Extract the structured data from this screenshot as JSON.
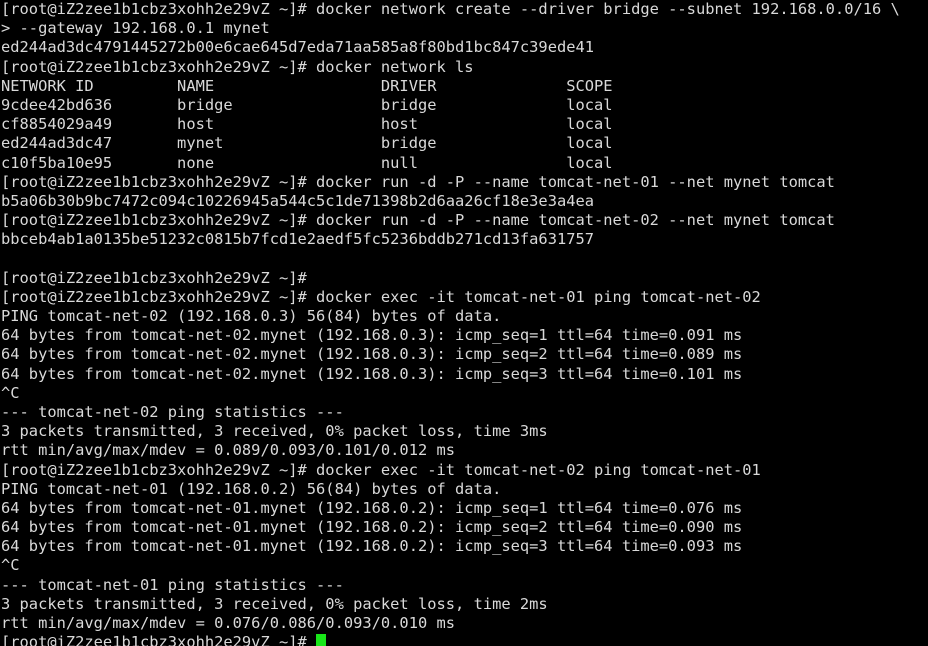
{
  "terminal": {
    "title": "root@iZ2zee1b1cbz3xohh2e29vZ",
    "prompt": "[root@iZ2zee1b1cbz3xohh2e29vZ ~]#",
    "continuation_prompt": ">",
    "foreground_color": "#d9d9d9",
    "background_color": "#000000",
    "cursor_color": "#19e619",
    "columns": 96,
    "rows": 34
  },
  "lines": [
    "[root@iZ2zee1b1cbz3xohh2e29vZ ~]# docker network create --driver bridge --subnet 192.168.0.0/16 \\",
    "> --gateway 192.168.0.1 mynet",
    "ed244ad3dc4791445272b00e6cae645d7eda71aa585a8f80bd1bc847c39ede41",
    "[root@iZ2zee1b1cbz3xohh2e29vZ ~]# docker network ls",
    "NETWORK ID         NAME                  DRIVER              SCOPE",
    "9cdee42bd636       bridge                bridge              local",
    "cf8854029a49       host                  host                local",
    "ed244ad3dc47       mynet                 bridge              local",
    "c10f5ba10e95       none                  null                local",
    "[root@iZ2zee1b1cbz3xohh2e29vZ ~]# docker run -d -P --name tomcat-net-01 --net mynet tomcat",
    "b5a06b30b9bc7472c094c10226945a544c5c1de71398b2d6aa26cf18e3e3a4ea",
    "[root@iZ2zee1b1cbz3xohh2e29vZ ~]# docker run -d -P --name tomcat-net-02 --net mynet tomcat",
    "bbceb4ab1a0135be51232c0815b7fcd1e2aedf5fc5236bddb271cd13fa631757",
    "",
    "[root@iZ2zee1b1cbz3xohh2e29vZ ~]#",
    "[root@iZ2zee1b1cbz3xohh2e29vZ ~]# docker exec -it tomcat-net-01 ping tomcat-net-02",
    "PING tomcat-net-02 (192.168.0.3) 56(84) bytes of data.",
    "64 bytes from tomcat-net-02.mynet (192.168.0.3): icmp_seq=1 ttl=64 time=0.091 ms",
    "64 bytes from tomcat-net-02.mynet (192.168.0.3): icmp_seq=2 ttl=64 time=0.089 ms",
    "64 bytes from tomcat-net-02.mynet (192.168.0.3): icmp_seq=3 ttl=64 time=0.101 ms",
    "^C",
    "--- tomcat-net-02 ping statistics ---",
    "3 packets transmitted, 3 received, 0% packet loss, time 3ms",
    "rtt min/avg/max/mdev = 0.089/0.093/0.101/0.012 ms",
    "[root@iZ2zee1b1cbz3xohh2e29vZ ~]# docker exec -it tomcat-net-02 ping tomcat-net-01",
    "PING tomcat-net-01 (192.168.0.2) 56(84) bytes of data.",
    "64 bytes from tomcat-net-01.mynet (192.168.0.2): icmp_seq=1 ttl=64 time=0.076 ms",
    "64 bytes from tomcat-net-01.mynet (192.168.0.2): icmp_seq=2 ttl=64 time=0.090 ms",
    "64 bytes from tomcat-net-01.mynet (192.168.0.2): icmp_seq=3 ttl=64 time=0.093 ms",
    "^C",
    "--- tomcat-net-01 ping statistics ---",
    "3 packets transmitted, 3 received, 0% packet loss, time 2ms",
    "rtt min/avg/max/mdev = 0.076/0.086/0.093/0.010 ms"
  ],
  "prompt_line": {
    "text": "[root@iZ2zee1b1cbz3xohh2e29vZ ~]# ",
    "cursor": "block"
  },
  "network_table": {
    "headers": [
      "NETWORK ID",
      "NAME",
      "DRIVER",
      "SCOPE"
    ],
    "rows": [
      [
        "9cdee42bd636",
        "bridge",
        "bridge",
        "local"
      ],
      [
        "cf8854029a49",
        "host",
        "host",
        "local"
      ],
      [
        "ed244ad3dc47",
        "mynet",
        "bridge",
        "local"
      ],
      [
        "c10f5ba10e95",
        "none",
        "null",
        "local"
      ]
    ]
  },
  "commands": [
    "docker network create --driver bridge --subnet 192.168.0.0/16 \\ --gateway 192.168.0.1 mynet",
    "docker network ls",
    "docker run -d -P --name tomcat-net-01 --net mynet tomcat",
    "docker run -d -P --name tomcat-net-02 --net mynet tomcat",
    "docker exec -it tomcat-net-01 ping tomcat-net-02",
    "docker exec -it tomcat-net-02 ping tomcat-net-01"
  ]
}
